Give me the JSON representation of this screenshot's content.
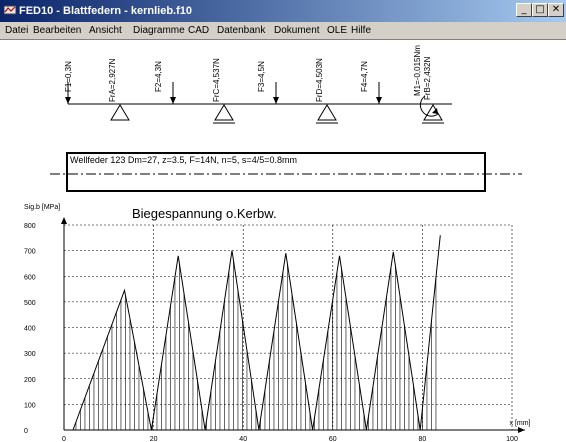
{
  "window": {
    "title": "FED10 - Blattfedern  -  kernlieb.f10",
    "controls": {
      "minimize": "_",
      "maximize": "□",
      "close": "✕"
    }
  },
  "menu": [
    "Datei",
    "Bearbeiten",
    "Ansicht",
    "Diagramme",
    "CAD",
    "Datenbank",
    "Dokument",
    "OLE",
    "Hilfe"
  ],
  "beam": {
    "forces": [
      "F1=0,3N",
      "F2=4,3N",
      "F3=4,5N",
      "F4=4,7N"
    ],
    "reactions": [
      "FrA=2,927N",
      "FrC=4,537N",
      "FrD=4,503N",
      "FrB=2,432N"
    ],
    "moment": "M1=-0,015Nm"
  },
  "spring_box": {
    "text": "Wellfeder 123  Dm=27, z=3.5, F=14N, n=5, s=4/5=0.8mm"
  },
  "chart_data": {
    "type": "line",
    "title": "Biegespannung o.Kerbw.",
    "ylabel": "Sig.b [MPa]",
    "xlabel": "x [mm]",
    "xlim": [
      0,
      100
    ],
    "ylim": [
      0,
      800
    ],
    "xticks": [
      0,
      20,
      40,
      60,
      80,
      100
    ],
    "yticks": [
      0,
      100,
      200,
      300,
      400,
      500,
      600,
      700,
      800
    ],
    "grid": true,
    "series": [
      {
        "x": [
          2,
          13.5,
          19.5,
          25.5,
          31.5,
          37.5,
          43.5,
          49.5,
          55.5,
          61.5,
          67.5,
          73.5,
          79.5,
          84
        ],
        "values": [
          0,
          545,
          0,
          680,
          0,
          700,
          0,
          690,
          0,
          680,
          0,
          695,
          0,
          760
        ]
      }
    ]
  }
}
